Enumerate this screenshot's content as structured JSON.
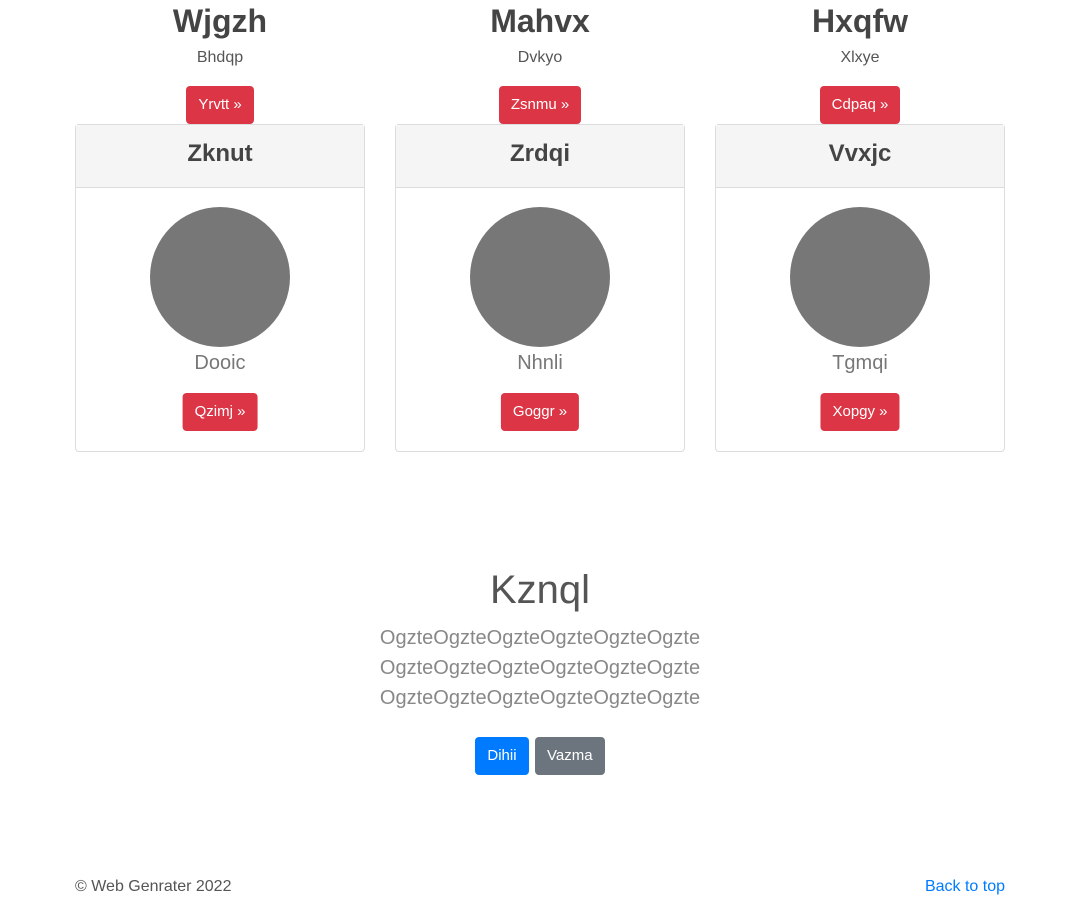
{
  "features": [
    {
      "title": "Wjgzh",
      "subtitle": "Bhdqp",
      "button": "Yrvtt »"
    },
    {
      "title": "Mahvx",
      "subtitle": "Dvkyo",
      "button": "Zsnmu »"
    },
    {
      "title": "Hxqfw",
      "subtitle": "Xlxye",
      "button": "Cdpaq »"
    }
  ],
  "cards": [
    {
      "header": "Zknut",
      "name": "Dooic",
      "button": "Qzimj »"
    },
    {
      "header": "Zrdqi",
      "name": "Nhnli",
      "button": "Goggr »"
    },
    {
      "header": "Vvxjc",
      "name": "Tgmqi",
      "button": "Xopgy »"
    }
  ],
  "hero": {
    "title": "Kznql",
    "lines": [
      "OgzteOgzteOgzteOgzteOgzteOgzte",
      "OgzteOgzteOgzteOgzteOgzteOgzte",
      "OgzteOgzteOgzteOgzteOgzteOgzte"
    ],
    "primary_button": "Dihii",
    "secondary_button": "Vazma"
  },
  "footer": {
    "copyright": "© Web Genrater 2022",
    "back_to_top": "Back to top"
  },
  "colors": {
    "danger": "#dc3545",
    "primary": "#007bff",
    "secondary": "#6c757d",
    "avatar": "#777777"
  }
}
